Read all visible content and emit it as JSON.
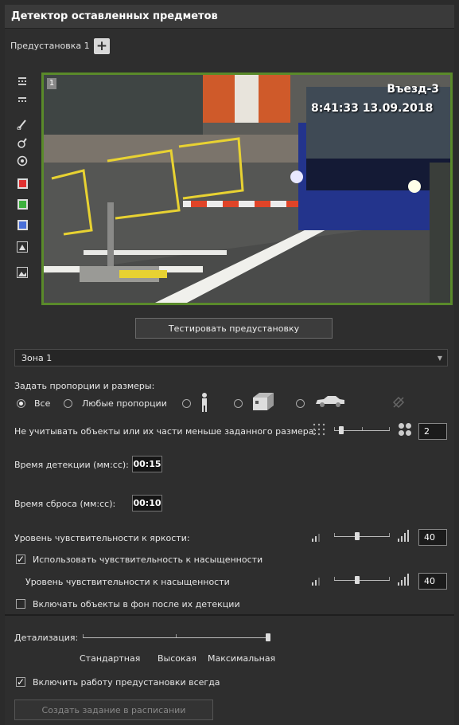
{
  "window": {
    "title": "Детектор оставленных предметов"
  },
  "preset": {
    "label": "Предустановка 1"
  },
  "toolbar": {
    "tools": [
      "grid-small-icon",
      "grid-large-icon",
      "brush-icon",
      "eraser-icon",
      "target-icon",
      "red-zone-icon",
      "green-zone-icon",
      "blue-zone-icon",
      "shapes-icon",
      "image-icon"
    ],
    "colors": {
      "red": "#e03030",
      "green": "#3db13d",
      "blue": "#4a6fd8"
    }
  },
  "video": {
    "camera_number": "1",
    "camera_name": "Въезд-3",
    "timestamp": "8:41:33  13.09.2018",
    "border_color": "#5a8a2a"
  },
  "test_button": {
    "label": "Тестировать предустановку"
  },
  "zone_select": {
    "value": "Зона 1"
  },
  "proportions": {
    "heading": "Задать пропорции и размеры:",
    "options": [
      {
        "label": "Все",
        "selected": true
      },
      {
        "label": "Любые пропорции",
        "selected": false
      },
      {
        "label": "",
        "icon": "person-icon",
        "selected": false
      },
      {
        "label": "",
        "icon": "box-icon",
        "selected": false
      },
      {
        "label": "",
        "icon": "car-icon",
        "selected": false
      }
    ]
  },
  "min_size": {
    "label": "Не учитывать объекты или их части меньше заданного размера:",
    "value": "2",
    "level": 0.1
  },
  "detection_time": {
    "label": "Время детекции (мм:сс):",
    "value": "00:15"
  },
  "reset_time": {
    "label": "Время сброса (мм:сс):",
    "value": "00:10"
  },
  "brightness": {
    "label": "Уровень чувствительности к яркости:",
    "value": "40",
    "level": 0.4
  },
  "use_saturation": {
    "label": "Использовать чувствительность к насыщенности",
    "checked": true
  },
  "saturation": {
    "label": "Уровень чувствительности к насыщенности",
    "value": "40",
    "level": 0.4
  },
  "background": {
    "label": "Включать объекты в фон после их детекции",
    "checked": false
  },
  "detail": {
    "label": "Детализация:",
    "levels": [
      "Стандартная",
      "Высокая",
      "Максимальная"
    ],
    "selected": "Максимальная"
  },
  "always_on": {
    "label": "Включить работу предустановки всегда",
    "checked": true
  },
  "schedule_button": {
    "label": "Создать задание в расписании"
  }
}
